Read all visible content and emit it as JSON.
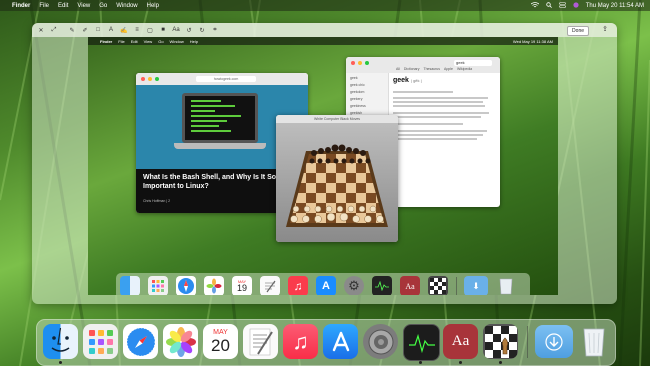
{
  "menubar": {
    "apple": "",
    "app_name": "Finder",
    "items": [
      "File",
      "Edit",
      "View",
      "Go",
      "Window",
      "Help"
    ],
    "clock": "Thu May 20  11:54 AM"
  },
  "quicklook": {
    "done_label": "Done"
  },
  "inner_screenshot": {
    "menubar": {
      "app_name": "Finder",
      "items": [
        "File",
        "Edit",
        "View",
        "Go",
        "Window",
        "Help"
      ],
      "clock": "Wed May 19  11:38 AM"
    },
    "browser": {
      "url": "howtogeek.com",
      "article_title": "What Is the Bash Shell, and Why Is It So Important to Linux?",
      "article_meta": "Chris Hoffman  |  2"
    },
    "dictionary": {
      "search": "geek",
      "tabs": [
        "All",
        "Dictionary",
        "Thesaurus",
        "Apple",
        "Wikipedia"
      ],
      "headword": "geek",
      "pronunciation": "| gēk |",
      "sidebar_items": [
        "geek",
        "geek chic",
        "geekdom",
        "geekery",
        "geekiness",
        "geekish",
        "geekspeak",
        "geeky"
      ]
    },
    "chess": {
      "title": "White  Computer  Black Moves"
    }
  },
  "dock": {
    "calendar_month": "MAY",
    "calendar_day": "20",
    "dictionary_glyph": "Aa"
  },
  "inner_dock": {
    "calendar_month": "MAY",
    "calendar_day": "19",
    "dictionary_glyph": "Aa"
  },
  "icons": [
    "apple-icon",
    "wifi-icon",
    "search-icon",
    "control-center-icon",
    "siri-icon",
    "finder-icon",
    "launchpad-icon",
    "safari-icon",
    "photos-icon",
    "calendar-icon",
    "textedit-icon",
    "music-icon",
    "app-store-icon",
    "system-preferences-icon",
    "activity-monitor-icon",
    "dictionary-icon",
    "chess-icon",
    "downloads-folder-icon",
    "trash-icon"
  ],
  "colors": {
    "grass_dark": "#24500f",
    "grass_light": "#7cc04a",
    "music_red": "#fa3c4c",
    "appstore_blue": "#1a8cff",
    "dictionary_red": "#a8343a"
  }
}
